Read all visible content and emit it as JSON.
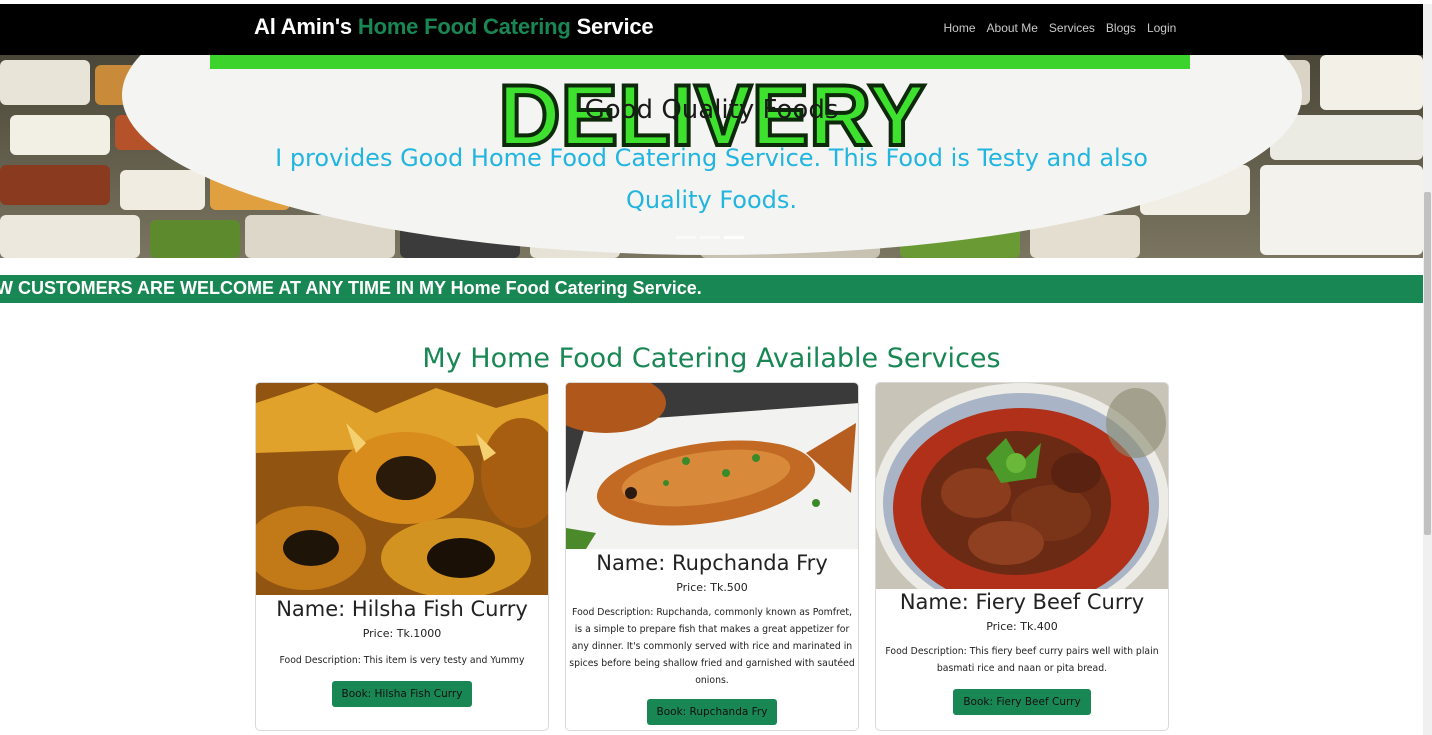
{
  "navbar": {
    "brand_part1": "Al Amin's",
    "brand_part2": "Home Food Catering",
    "brand_part3": "Service",
    "links": [
      "Home",
      "About Me",
      "Services",
      "Blogs",
      "Login"
    ]
  },
  "hero": {
    "title": "Good Quality Foods",
    "subtitle": "I provides Good Home Food Catering Service. This Food is Testy and also Quality Foods.",
    "background_text": "DELIVERY",
    "slide_count": 3,
    "active_slide": 3
  },
  "marquee": {
    "text": "W CUSTOMERS ARE WELCOME AT ANY TIME IN MY Home Food Catering Service."
  },
  "services": {
    "title": "My Home Food Catering Available Services",
    "cards": [
      {
        "name": "Name: Hilsha Fish Curry",
        "price": "Price: Tk.1000",
        "description": "Food Description: This item is very testy and Yummy",
        "button": "Book: Hilsha Fish Curry",
        "image": "hilsha-fish-curry-photo"
      },
      {
        "name": "Name: Rupchanda Fry",
        "price": "Price: Tk.500",
        "description": "Food Description: Rupchanda, commonly known as Pomfret, is a simple to prepare fish that makes a great appetizer for any dinner. It's commonly served with rice and marinated in spices before being shallow fried and garnished with sautéed onions.",
        "button": "Book: Rupchanda Fry",
        "image": "rupchanda-fry-photo"
      },
      {
        "name": "Name: Fiery Beef Curry",
        "price": "Price: Tk.400",
        "description": "Food Description: This fiery beef curry pairs well with plain basmati rice and naan or pita bread.",
        "button": "Book: Fiery Beef Curry",
        "image": "fiery-beef-curry-photo"
      }
    ]
  },
  "colors": {
    "accent": "#198754",
    "navbar_bg": "#000000",
    "hero_subtitle": "#21b5e0"
  }
}
